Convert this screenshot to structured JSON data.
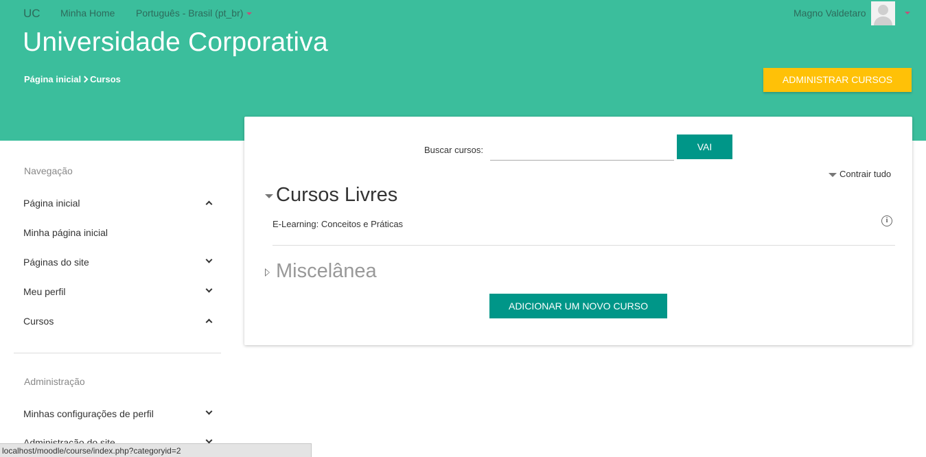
{
  "topnav": {
    "brand": "UC",
    "home_link": "Minha Home",
    "language": "Português - Brasil (pt_br)",
    "user_name": "Magno Valdetaro"
  },
  "header": {
    "site_title": "Universidade Corporativa",
    "breadcrumb": [
      "Página inicial",
      "Cursos"
    ],
    "admin_button": "ADMINISTRAR CURSOS"
  },
  "sidebar": {
    "navigation_heading": "Navegação",
    "navigation_items": [
      {
        "label": "Página inicial",
        "chevron": "up"
      },
      {
        "label": "Minha página inicial",
        "chevron": ""
      },
      {
        "label": "Páginas do site",
        "chevron": "down"
      },
      {
        "label": "Meu perfil",
        "chevron": "down"
      },
      {
        "label": "Cursos",
        "chevron": "up"
      }
    ],
    "admin_heading": "Administração",
    "admin_items": [
      {
        "label": "Minhas configurações de perfil",
        "chevron": "down"
      },
      {
        "label": "Administração do site",
        "chevron": "down"
      }
    ]
  },
  "main": {
    "search_label": "Buscar cursos:",
    "search_value": "",
    "go_button": "VAI",
    "collapse_all": "Contrair tudo",
    "categories": [
      {
        "name": "Cursos Livres",
        "expanded": true,
        "courses": [
          "E-Learning: Conceitos e Práticas"
        ]
      },
      {
        "name": "Miscelânea",
        "expanded": false,
        "courses": []
      }
    ],
    "add_course_button": "ADICIONAR UM NOVO CURSO"
  },
  "statusbar": {
    "url": "localhost/moodle/course/index.php?categoryid=2"
  },
  "colors": {
    "header_bg": "#3bbe9c",
    "accent_button": "#ffc107",
    "primary_button": "#009688"
  }
}
